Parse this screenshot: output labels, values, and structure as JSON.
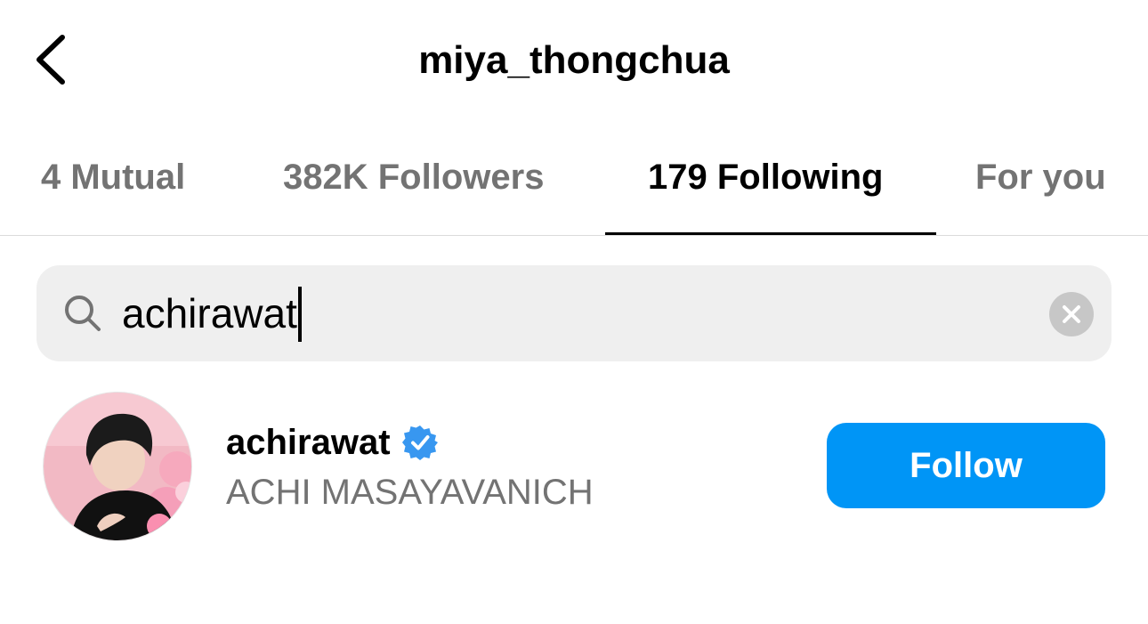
{
  "header": {
    "title": "miya_thongchua",
    "back_icon": "chevron-left-icon"
  },
  "tabs": [
    {
      "label": "4 Mutual",
      "active": false
    },
    {
      "label": "382K Followers",
      "active": false
    },
    {
      "label": "179 Following",
      "active": true
    },
    {
      "label": "For you",
      "active": false
    }
  ],
  "search": {
    "value": "achirawat",
    "icon": "search-icon",
    "clear_icon": "clear-icon"
  },
  "results": [
    {
      "username": "achirawat",
      "verified": true,
      "full_name": "ACHI MASAYAVANICH",
      "action_label": "Follow",
      "avatar_icon": "avatar"
    }
  ],
  "colors": {
    "primary_button": "#0095f6",
    "verified_badge": "#3897f0",
    "secondary_text": "#737373",
    "search_background": "#efefef"
  }
}
